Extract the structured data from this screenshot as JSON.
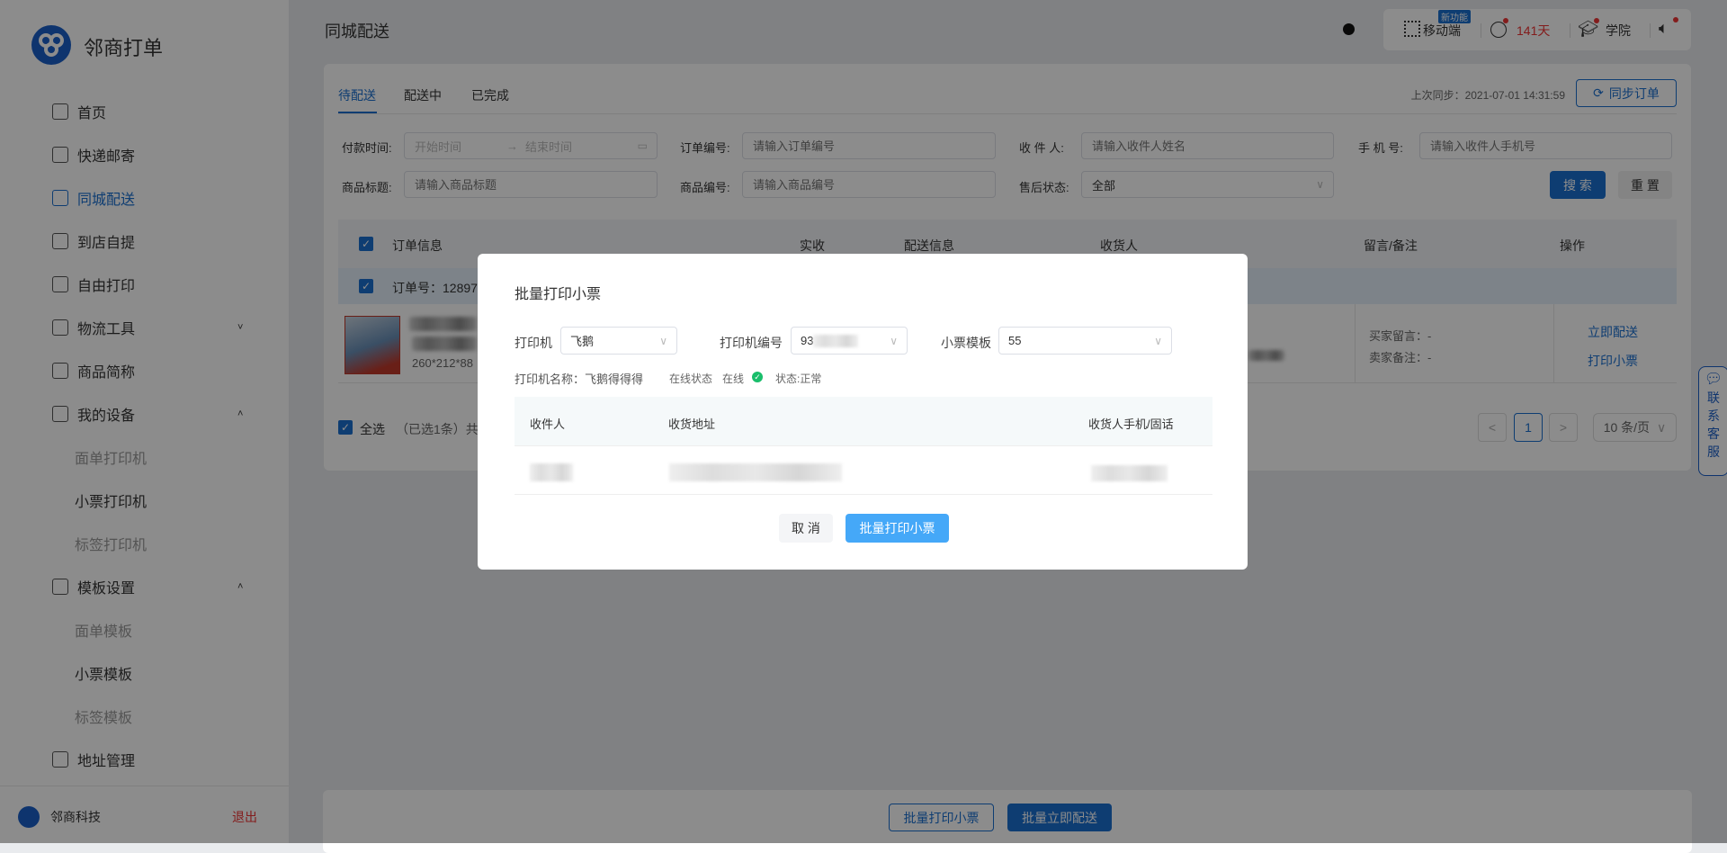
{
  "app": {
    "brand": "邻商打单",
    "page_title": "同城配送"
  },
  "colors": {
    "primary": "#1a6fd0",
    "dialog_primary": "#45a8f8",
    "danger": "#e33333",
    "online": "#19be6b"
  },
  "sidebar": {
    "items": [
      {
        "label": "首页",
        "icon": "home-icon"
      },
      {
        "label": "快递邮寄",
        "icon": "clipboard-icon"
      },
      {
        "label": "同城配送",
        "icon": "courier-icon",
        "active": true
      },
      {
        "label": "到店自提",
        "icon": "bag-icon"
      },
      {
        "label": "自由打印",
        "icon": "printer-icon"
      },
      {
        "label": "物流工具",
        "icon": "truck-icon",
        "chevron": "˅"
      },
      {
        "label": "商品简称",
        "icon": "jian-icon"
      },
      {
        "label": "我的设备",
        "icon": "device-icon",
        "chevron": "˄"
      },
      {
        "label": "面单打印机",
        "sub": true
      },
      {
        "label": "小票打印机",
        "sub": true,
        "dark": true
      },
      {
        "label": "标签打印机",
        "sub": true
      },
      {
        "label": "模板设置",
        "icon": "template-icon",
        "chevron": "˄"
      },
      {
        "label": "面单模板",
        "sub": true
      },
      {
        "label": "小票模板",
        "sub": true,
        "dark": true
      },
      {
        "label": "标签模板",
        "sub": true
      },
      {
        "label": "地址管理",
        "icon": "location-icon"
      }
    ],
    "footer": {
      "company": "邻商科技",
      "logout": "退出"
    }
  },
  "toolbar": {
    "mobile": "移动端",
    "new_badge": "新功能",
    "days": "141天",
    "academy": "学院"
  },
  "tabs": [
    "待配送",
    "配送中",
    "已完成"
  ],
  "sync": {
    "last_sync": "上次同步：2021-07-01 14:31:59",
    "button": "同步订单"
  },
  "filters": {
    "pay_time_label": "付款时间:",
    "start_placeholder": "开始时间",
    "end_placeholder": "结束时间",
    "order_no_label": "订单编号:",
    "order_no_placeholder": "请输入订单编号",
    "receiver_label": "收 件 人:",
    "receiver_placeholder": "请输入收件人姓名",
    "phone_label": "手 机 号:",
    "phone_placeholder": "请输入收件人手机号",
    "title_label": "商品标题:",
    "title_placeholder": "请输入商品标题",
    "goods_no_label": "商品编号:",
    "goods_no_placeholder": "请输入商品编号",
    "after_sale_label": "售后状态:",
    "after_sale_value": "全部",
    "search": "搜 索",
    "reset": "重 置"
  },
  "table": {
    "headers": [
      "订单信息",
      "实收",
      "配送信息",
      "收货人",
      "留言/备注",
      "操作"
    ],
    "order_no": "订单号：12897",
    "spec": "260*212*88",
    "buyer_msg": "买家留言：-",
    "seller_note": "卖家备注：-",
    "actions": [
      "立即配送",
      "打印小票"
    ]
  },
  "footer": {
    "select_all": "全选",
    "selected": "（已选1条）共",
    "page": "1",
    "page_size": "10 条/页",
    "prev": "<",
    "next": ">"
  },
  "chat": {
    "label": [
      "联",
      "系",
      "客",
      "服"
    ]
  },
  "bottom": {
    "print": "批量打印小票",
    "deliver": "批量立即配送"
  },
  "dialog": {
    "title": "批量打印小票",
    "printer_label": "打印机",
    "printer_value": "飞鹅",
    "printer_no_label": "打印机编号",
    "printer_no_value": "93",
    "template_label": "小票模板",
    "template_value": "55",
    "printer_name": "打印机名称：飞鹅得得得",
    "online_label": "在线状态",
    "online_value": "在线",
    "status": "状态:正常",
    "headers": [
      "收件人",
      "收货地址",
      "收货人手机/固话"
    ],
    "cancel": "取 消",
    "confirm": "批量打印小票"
  }
}
